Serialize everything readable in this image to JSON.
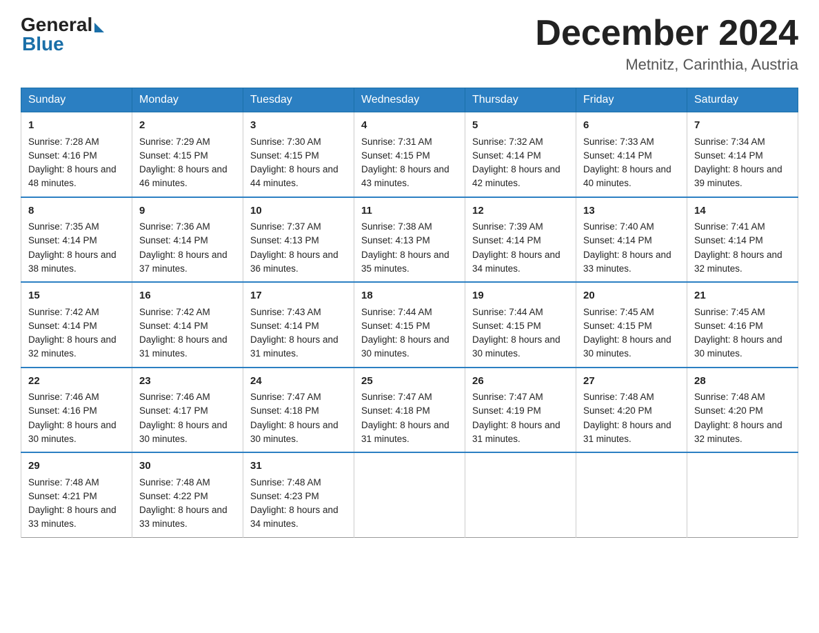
{
  "header": {
    "logo_general": "General",
    "logo_blue": "Blue",
    "month_title": "December 2024",
    "location": "Metnitz, Carinthia, Austria"
  },
  "days_of_week": [
    "Sunday",
    "Monday",
    "Tuesday",
    "Wednesday",
    "Thursday",
    "Friday",
    "Saturday"
  ],
  "weeks": [
    [
      {
        "day": "1",
        "sunrise": "Sunrise: 7:28 AM",
        "sunset": "Sunset: 4:16 PM",
        "daylight": "Daylight: 8 hours and 48 minutes."
      },
      {
        "day": "2",
        "sunrise": "Sunrise: 7:29 AM",
        "sunset": "Sunset: 4:15 PM",
        "daylight": "Daylight: 8 hours and 46 minutes."
      },
      {
        "day": "3",
        "sunrise": "Sunrise: 7:30 AM",
        "sunset": "Sunset: 4:15 PM",
        "daylight": "Daylight: 8 hours and 44 minutes."
      },
      {
        "day": "4",
        "sunrise": "Sunrise: 7:31 AM",
        "sunset": "Sunset: 4:15 PM",
        "daylight": "Daylight: 8 hours and 43 minutes."
      },
      {
        "day": "5",
        "sunrise": "Sunrise: 7:32 AM",
        "sunset": "Sunset: 4:14 PM",
        "daylight": "Daylight: 8 hours and 42 minutes."
      },
      {
        "day": "6",
        "sunrise": "Sunrise: 7:33 AM",
        "sunset": "Sunset: 4:14 PM",
        "daylight": "Daylight: 8 hours and 40 minutes."
      },
      {
        "day": "7",
        "sunrise": "Sunrise: 7:34 AM",
        "sunset": "Sunset: 4:14 PM",
        "daylight": "Daylight: 8 hours and 39 minutes."
      }
    ],
    [
      {
        "day": "8",
        "sunrise": "Sunrise: 7:35 AM",
        "sunset": "Sunset: 4:14 PM",
        "daylight": "Daylight: 8 hours and 38 minutes."
      },
      {
        "day": "9",
        "sunrise": "Sunrise: 7:36 AM",
        "sunset": "Sunset: 4:14 PM",
        "daylight": "Daylight: 8 hours and 37 minutes."
      },
      {
        "day": "10",
        "sunrise": "Sunrise: 7:37 AM",
        "sunset": "Sunset: 4:13 PM",
        "daylight": "Daylight: 8 hours and 36 minutes."
      },
      {
        "day": "11",
        "sunrise": "Sunrise: 7:38 AM",
        "sunset": "Sunset: 4:13 PM",
        "daylight": "Daylight: 8 hours and 35 minutes."
      },
      {
        "day": "12",
        "sunrise": "Sunrise: 7:39 AM",
        "sunset": "Sunset: 4:14 PM",
        "daylight": "Daylight: 8 hours and 34 minutes."
      },
      {
        "day": "13",
        "sunrise": "Sunrise: 7:40 AM",
        "sunset": "Sunset: 4:14 PM",
        "daylight": "Daylight: 8 hours and 33 minutes."
      },
      {
        "day": "14",
        "sunrise": "Sunrise: 7:41 AM",
        "sunset": "Sunset: 4:14 PM",
        "daylight": "Daylight: 8 hours and 32 minutes."
      }
    ],
    [
      {
        "day": "15",
        "sunrise": "Sunrise: 7:42 AM",
        "sunset": "Sunset: 4:14 PM",
        "daylight": "Daylight: 8 hours and 32 minutes."
      },
      {
        "day": "16",
        "sunrise": "Sunrise: 7:42 AM",
        "sunset": "Sunset: 4:14 PM",
        "daylight": "Daylight: 8 hours and 31 minutes."
      },
      {
        "day": "17",
        "sunrise": "Sunrise: 7:43 AM",
        "sunset": "Sunset: 4:14 PM",
        "daylight": "Daylight: 8 hours and 31 minutes."
      },
      {
        "day": "18",
        "sunrise": "Sunrise: 7:44 AM",
        "sunset": "Sunset: 4:15 PM",
        "daylight": "Daylight: 8 hours and 30 minutes."
      },
      {
        "day": "19",
        "sunrise": "Sunrise: 7:44 AM",
        "sunset": "Sunset: 4:15 PM",
        "daylight": "Daylight: 8 hours and 30 minutes."
      },
      {
        "day": "20",
        "sunrise": "Sunrise: 7:45 AM",
        "sunset": "Sunset: 4:15 PM",
        "daylight": "Daylight: 8 hours and 30 minutes."
      },
      {
        "day": "21",
        "sunrise": "Sunrise: 7:45 AM",
        "sunset": "Sunset: 4:16 PM",
        "daylight": "Daylight: 8 hours and 30 minutes."
      }
    ],
    [
      {
        "day": "22",
        "sunrise": "Sunrise: 7:46 AM",
        "sunset": "Sunset: 4:16 PM",
        "daylight": "Daylight: 8 hours and 30 minutes."
      },
      {
        "day": "23",
        "sunrise": "Sunrise: 7:46 AM",
        "sunset": "Sunset: 4:17 PM",
        "daylight": "Daylight: 8 hours and 30 minutes."
      },
      {
        "day": "24",
        "sunrise": "Sunrise: 7:47 AM",
        "sunset": "Sunset: 4:18 PM",
        "daylight": "Daylight: 8 hours and 30 minutes."
      },
      {
        "day": "25",
        "sunrise": "Sunrise: 7:47 AM",
        "sunset": "Sunset: 4:18 PM",
        "daylight": "Daylight: 8 hours and 31 minutes."
      },
      {
        "day": "26",
        "sunrise": "Sunrise: 7:47 AM",
        "sunset": "Sunset: 4:19 PM",
        "daylight": "Daylight: 8 hours and 31 minutes."
      },
      {
        "day": "27",
        "sunrise": "Sunrise: 7:48 AM",
        "sunset": "Sunset: 4:20 PM",
        "daylight": "Daylight: 8 hours and 31 minutes."
      },
      {
        "day": "28",
        "sunrise": "Sunrise: 7:48 AM",
        "sunset": "Sunset: 4:20 PM",
        "daylight": "Daylight: 8 hours and 32 minutes."
      }
    ],
    [
      {
        "day": "29",
        "sunrise": "Sunrise: 7:48 AM",
        "sunset": "Sunset: 4:21 PM",
        "daylight": "Daylight: 8 hours and 33 minutes."
      },
      {
        "day": "30",
        "sunrise": "Sunrise: 7:48 AM",
        "sunset": "Sunset: 4:22 PM",
        "daylight": "Daylight: 8 hours and 33 minutes."
      },
      {
        "day": "31",
        "sunrise": "Sunrise: 7:48 AM",
        "sunset": "Sunset: 4:23 PM",
        "daylight": "Daylight: 8 hours and 34 minutes."
      },
      null,
      null,
      null,
      null
    ]
  ]
}
